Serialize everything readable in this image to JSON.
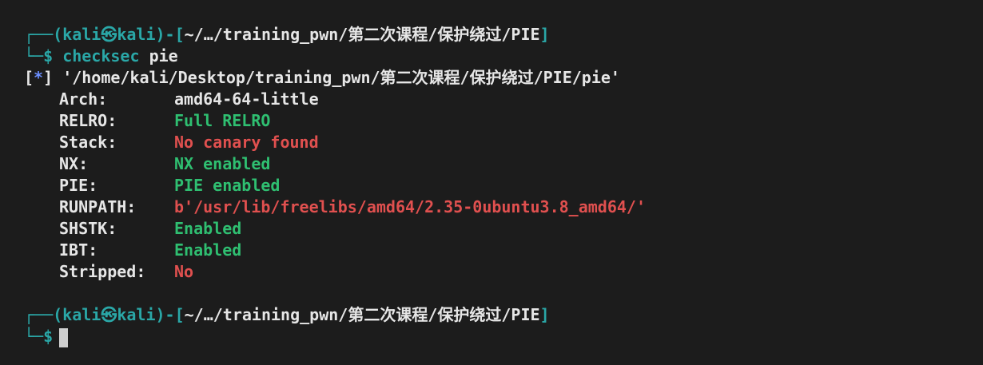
{
  "session1": {
    "frame_top": "┌──(",
    "user": "kali",
    "at_icon": "㉿",
    "host": "kali",
    "frame_mid": ")-[",
    "path": "~/…/training_pwn/第二次课程/保护绕过/PIE",
    "frame_end": "]",
    "frame_bottom": "└─",
    "prompt": "$",
    "command": "checksec",
    "arg": "pie"
  },
  "output": {
    "marker_open": "[",
    "marker_star": "*",
    "marker_close": "]",
    "file_path": "'/home/kali/Desktop/training_pwn/第二次课程/保护绕过/PIE/pie'",
    "rows": [
      {
        "key": "Arch:",
        "value": "amd64-64-little",
        "color": "white"
      },
      {
        "key": "RELRO:",
        "value": "Full RELRO",
        "color": "green"
      },
      {
        "key": "Stack:",
        "value": "No canary found",
        "color": "red"
      },
      {
        "key": "NX:",
        "value": "NX enabled",
        "color": "green"
      },
      {
        "key": "PIE:",
        "value": "PIE enabled",
        "color": "green"
      },
      {
        "key": "RUNPATH:",
        "value": "b'/usr/lib/freelibs/amd64/2.35-0ubuntu3.8_amd64/'",
        "color": "red"
      },
      {
        "key": "SHSTK:",
        "value": "Enabled",
        "color": "green"
      },
      {
        "key": "IBT:",
        "value": "Enabled",
        "color": "green"
      },
      {
        "key": "Stripped:",
        "value": "No",
        "color": "red"
      }
    ]
  },
  "session2": {
    "frame_top": "┌──(",
    "user": "kali",
    "at_icon": "㉿",
    "host": "kali",
    "frame_mid": ")-[",
    "path": "~/…/training_pwn/第二次课程/保护绕过/PIE",
    "frame_end": "]",
    "frame_bottom": "└─",
    "prompt": "$"
  },
  "colors": {
    "background": "#1c1c1c",
    "accent": "#2aa7a7",
    "green": "#2fbf71",
    "red": "#e0504f",
    "text": "#e6e6e6"
  }
}
